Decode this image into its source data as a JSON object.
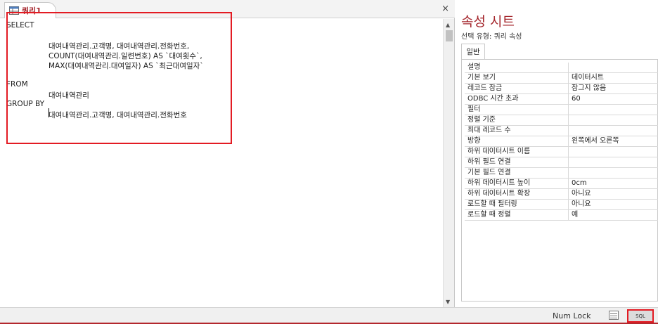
{
  "tab": {
    "label": "쿼리1",
    "close": "×"
  },
  "sql": {
    "select_kw": "SELECT",
    "select_l1": "대여내역관리.고객명, 대여내역관리.전화번호,",
    "select_l2": "COUNT(대여내역관리.일련번호) AS `대여횟수`,",
    "select_l3": "MAX(대여내역관리.대여일자) AS `최근대여일자`",
    "from_kw": "FROM",
    "from_l1": "대여내역관리",
    "group_kw": "GROUP BY",
    "group_l1": "대여내역관리.고객명, 대여내역관리.전화번호"
  },
  "property_sheet": {
    "title": "속성 시트",
    "selection_type": "선택 유형:  쿼리 속성",
    "tab_label": "일반",
    "rows": [
      {
        "k": "설명",
        "v": ""
      },
      {
        "k": "기본 보기",
        "v": "데이터시트"
      },
      {
        "k": "레코드 잠금",
        "v": "잠그지 않음"
      },
      {
        "k": "ODBC 시간 초과",
        "v": "60"
      },
      {
        "k": "필터",
        "v": ""
      },
      {
        "k": "정렬 기준",
        "v": ""
      },
      {
        "k": "최대 레코드 수",
        "v": ""
      },
      {
        "k": "방향",
        "v": "왼쪽에서 오른쪽"
      },
      {
        "k": "하위 데이터시트 이름",
        "v": ""
      },
      {
        "k": "하위 필드 연결",
        "v": ""
      },
      {
        "k": "기본 필드 연결",
        "v": ""
      },
      {
        "k": "하위 데이터시트 높이",
        "v": "0cm"
      },
      {
        "k": "하위 데이터시트 확장",
        "v": "아니요"
      },
      {
        "k": "로드할 때 필터링",
        "v": "아니요"
      },
      {
        "k": "로드할 때 정렬",
        "v": "예"
      }
    ]
  },
  "status": {
    "numlock": "Num Lock",
    "sql_label": "SQL"
  },
  "icons": {
    "table": "query-table-icon",
    "datasheet": "datasheet-view-icon"
  }
}
